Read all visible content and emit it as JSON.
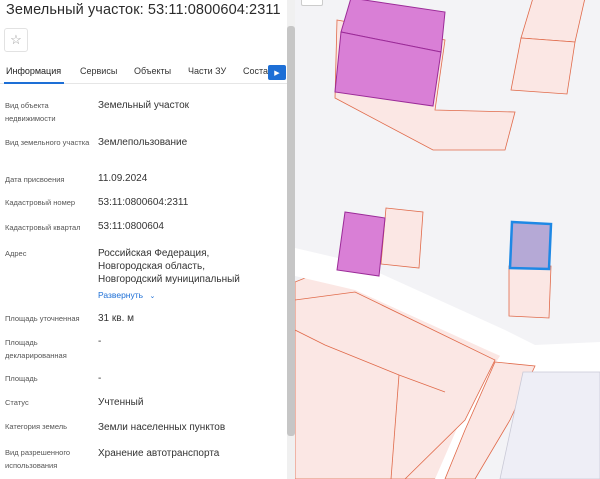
{
  "header": {
    "title": "Земельный участок: 53:11:0800604:2311"
  },
  "tabs": [
    {
      "label": "Информация",
      "active": true
    },
    {
      "label": "Сервисы"
    },
    {
      "label": "Объекты"
    },
    {
      "label": "Части ЗУ"
    },
    {
      "label": "Соста"
    }
  ],
  "info": {
    "object_type": {
      "label": "Вид объекта недвижимости",
      "value": "Земельный участок"
    },
    "land_type": {
      "label": "Вид земельного участка",
      "value": "Землепользование"
    },
    "assign_date": {
      "label": "Дата присвоения",
      "value": "11.09.2024"
    },
    "cadastral_number": {
      "label": "Кадастровый номер",
      "value": "53:11:0800604:2311"
    },
    "cadastral_quarter": {
      "label": "Кадастровый квартал",
      "value": "53:11:0800604"
    },
    "address": {
      "label": "Адрес",
      "line1": "Российская Федерация,",
      "line2": "Новгородская область,",
      "line3": "Новгородский муниципальный",
      "expand": "Развернуть"
    },
    "area_specified": {
      "label": "Площадь уточненная",
      "value": "31 кв. м"
    },
    "area_declared": {
      "label": "Площадь декларированная",
      "value": "-"
    },
    "area": {
      "label": "Площадь",
      "value": "-"
    },
    "status": {
      "label": "Статус",
      "value": "Учтенный"
    },
    "land_category": {
      "label": "Категория земель",
      "value": "Земли населенных пунктов"
    },
    "permitted_use": {
      "label": "Вид разрешенного использования",
      "value": "Хранение автотранспорта"
    }
  },
  "colors": {
    "accent": "#1d6fd6",
    "parcel_fill": "#fbe7e4",
    "parcel_stroke": "#e06a4a",
    "building_fill": "#d97fd6",
    "building_stroke": "#9b2b98",
    "selected_fill": "#b5a9d6",
    "selected_stroke": "#1e88e5"
  },
  "icons": {
    "star": "star-icon",
    "tab_scroll": "chevron-right-icon",
    "expand": "chevron-down-icon"
  }
}
